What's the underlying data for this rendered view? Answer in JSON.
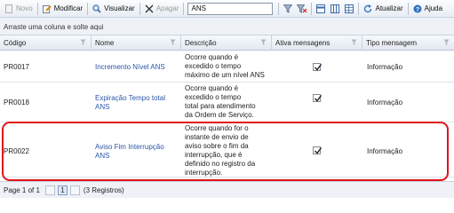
{
  "toolbar": {
    "new_label": "Novo",
    "modify_label": "Modificar",
    "view_label": "Visualizar",
    "delete_label": "Apagar",
    "search_value": "ANS",
    "refresh_label": "Atualizar",
    "help_label": "Ajuda"
  },
  "groupbar": {
    "hint": "Arraste uma coluna e solte aqui"
  },
  "columns": [
    "Código",
    "Nome",
    "Descrição",
    "Ativa mensagens",
    "Tipo mensagem"
  ],
  "rows": [
    {
      "code": "PR0017",
      "name": [
        "Incremento Nível ANS"
      ],
      "desc": [
        "Ocorre quando é",
        "excedido o tempo",
        "máximo de um nível ANS"
      ],
      "active": true,
      "type": "Informação"
    },
    {
      "code": "PR0018",
      "name": [
        "Expiração Tempo total",
        "ANS"
      ],
      "desc": [
        "Ocorre quando é",
        "excedido o tempo",
        "total para atendimento",
        "da Ordem de Serviço."
      ],
      "active": true,
      "type": "Informação"
    },
    {
      "code": "PR0022",
      "name": [
        "Aviso Fim Interrupção",
        "ANS"
      ],
      "desc": [
        "Ocorre quando for o",
        "instante de envio de",
        "aviso sobre o fim da",
        "interrupção, que é",
        "definido no registro da",
        "interrupção."
      ],
      "active": true,
      "type": "Informação"
    }
  ],
  "footer": {
    "page_info": "Page 1 of 1",
    "page_number": "1",
    "records": "(3 Registros)"
  },
  "colors": {
    "highlight": "#e0131b",
    "link": "#2b56a8"
  }
}
